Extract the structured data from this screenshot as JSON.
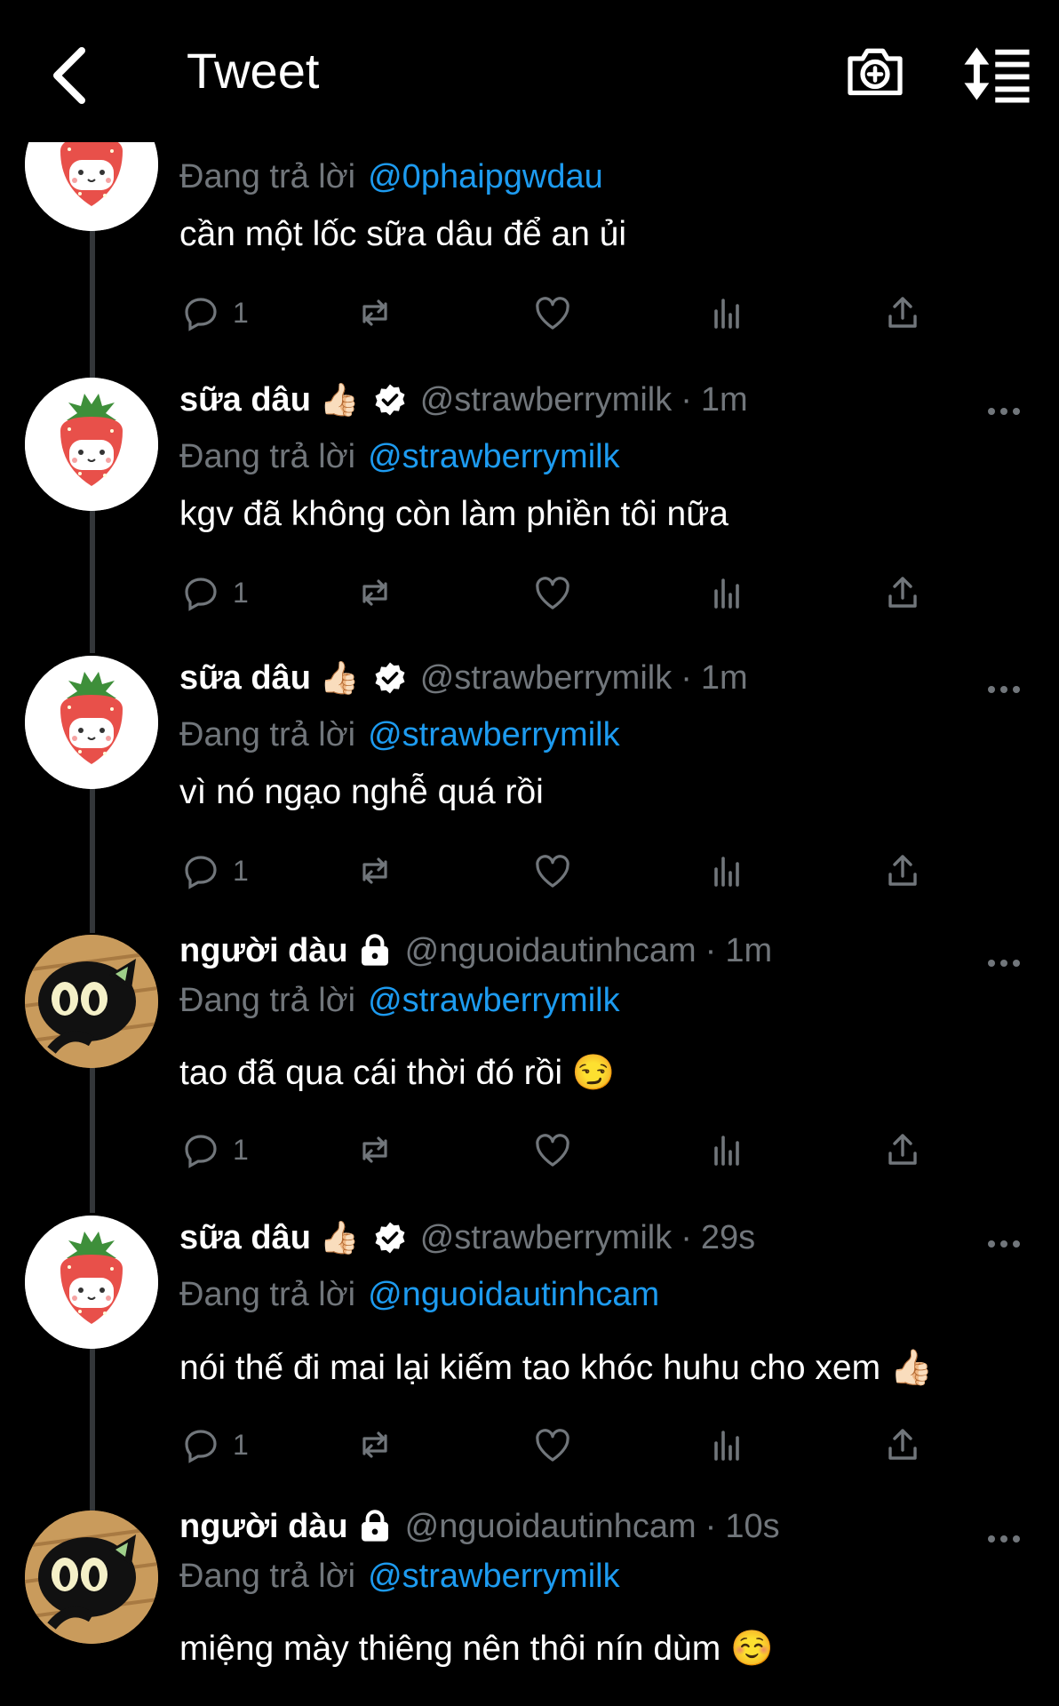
{
  "header": {
    "title": "Tweet"
  },
  "tweets": [
    {
      "name": "",
      "emoji": "",
      "handle": "",
      "time": "",
      "reply_label": "Đang trả lời",
      "reply_to": "@0phaipgwdau",
      "text": "cần một lốc sữa dâu để an ủi",
      "replies": "1"
    },
    {
      "name": "sữa dâu",
      "emoji": "👍🏻",
      "handle": "@strawberrymilk",
      "time": "1m",
      "reply_label": "Đang trả lời",
      "reply_to": "@strawberrymilk",
      "text": "kgv đã không còn làm phiền tôi nữa",
      "replies": "1"
    },
    {
      "name": "sữa dâu",
      "emoji": "👍🏻",
      "handle": "@strawberrymilk",
      "time": "1m",
      "reply_label": "Đang trả lời",
      "reply_to": "@strawberrymilk",
      "text": "vì nó ngạo nghễ quá rồi",
      "replies": "1"
    },
    {
      "name": "người dàu",
      "emoji": "",
      "handle": "@nguoidautinhcam",
      "time": "1m",
      "reply_label": "Đang trả lời",
      "reply_to": "@strawberrymilk",
      "text": "tao đã qua cái thời đó rồi 😏",
      "replies": "1"
    },
    {
      "name": "sữa dâu",
      "emoji": "👍🏻",
      "handle": "@strawberrymilk",
      "time": "29s",
      "reply_label": "Đang trả lời",
      "reply_to": "@nguoidautinhcam",
      "text": "nói thế đi mai lại kiếm tao khóc huhu cho xem 👍🏻",
      "replies": "1"
    },
    {
      "name": "người dàu",
      "emoji": "",
      "handle": "@nguoidautinhcam",
      "time": "10s",
      "reply_label": "Đang trả lời",
      "reply_to": "@strawberrymilk",
      "text": "miệng mày thiêng nên thôi nín dùm ☺️",
      "replies": ""
    }
  ],
  "icons": {
    "back": "chevron-left-icon",
    "camera": "camera-plus-icon",
    "sort": "sort-icon",
    "reply": "reply-icon",
    "retweet": "retweet-icon",
    "like": "heart-icon",
    "views": "views-icon",
    "share": "share-icon",
    "verified": "verified-icon",
    "lock": "lock-icon",
    "more": "more-icon"
  },
  "colors": {
    "background": "#000000",
    "mention": "#1d9bf0",
    "muted": "#71767b",
    "text": "#ffffff"
  }
}
